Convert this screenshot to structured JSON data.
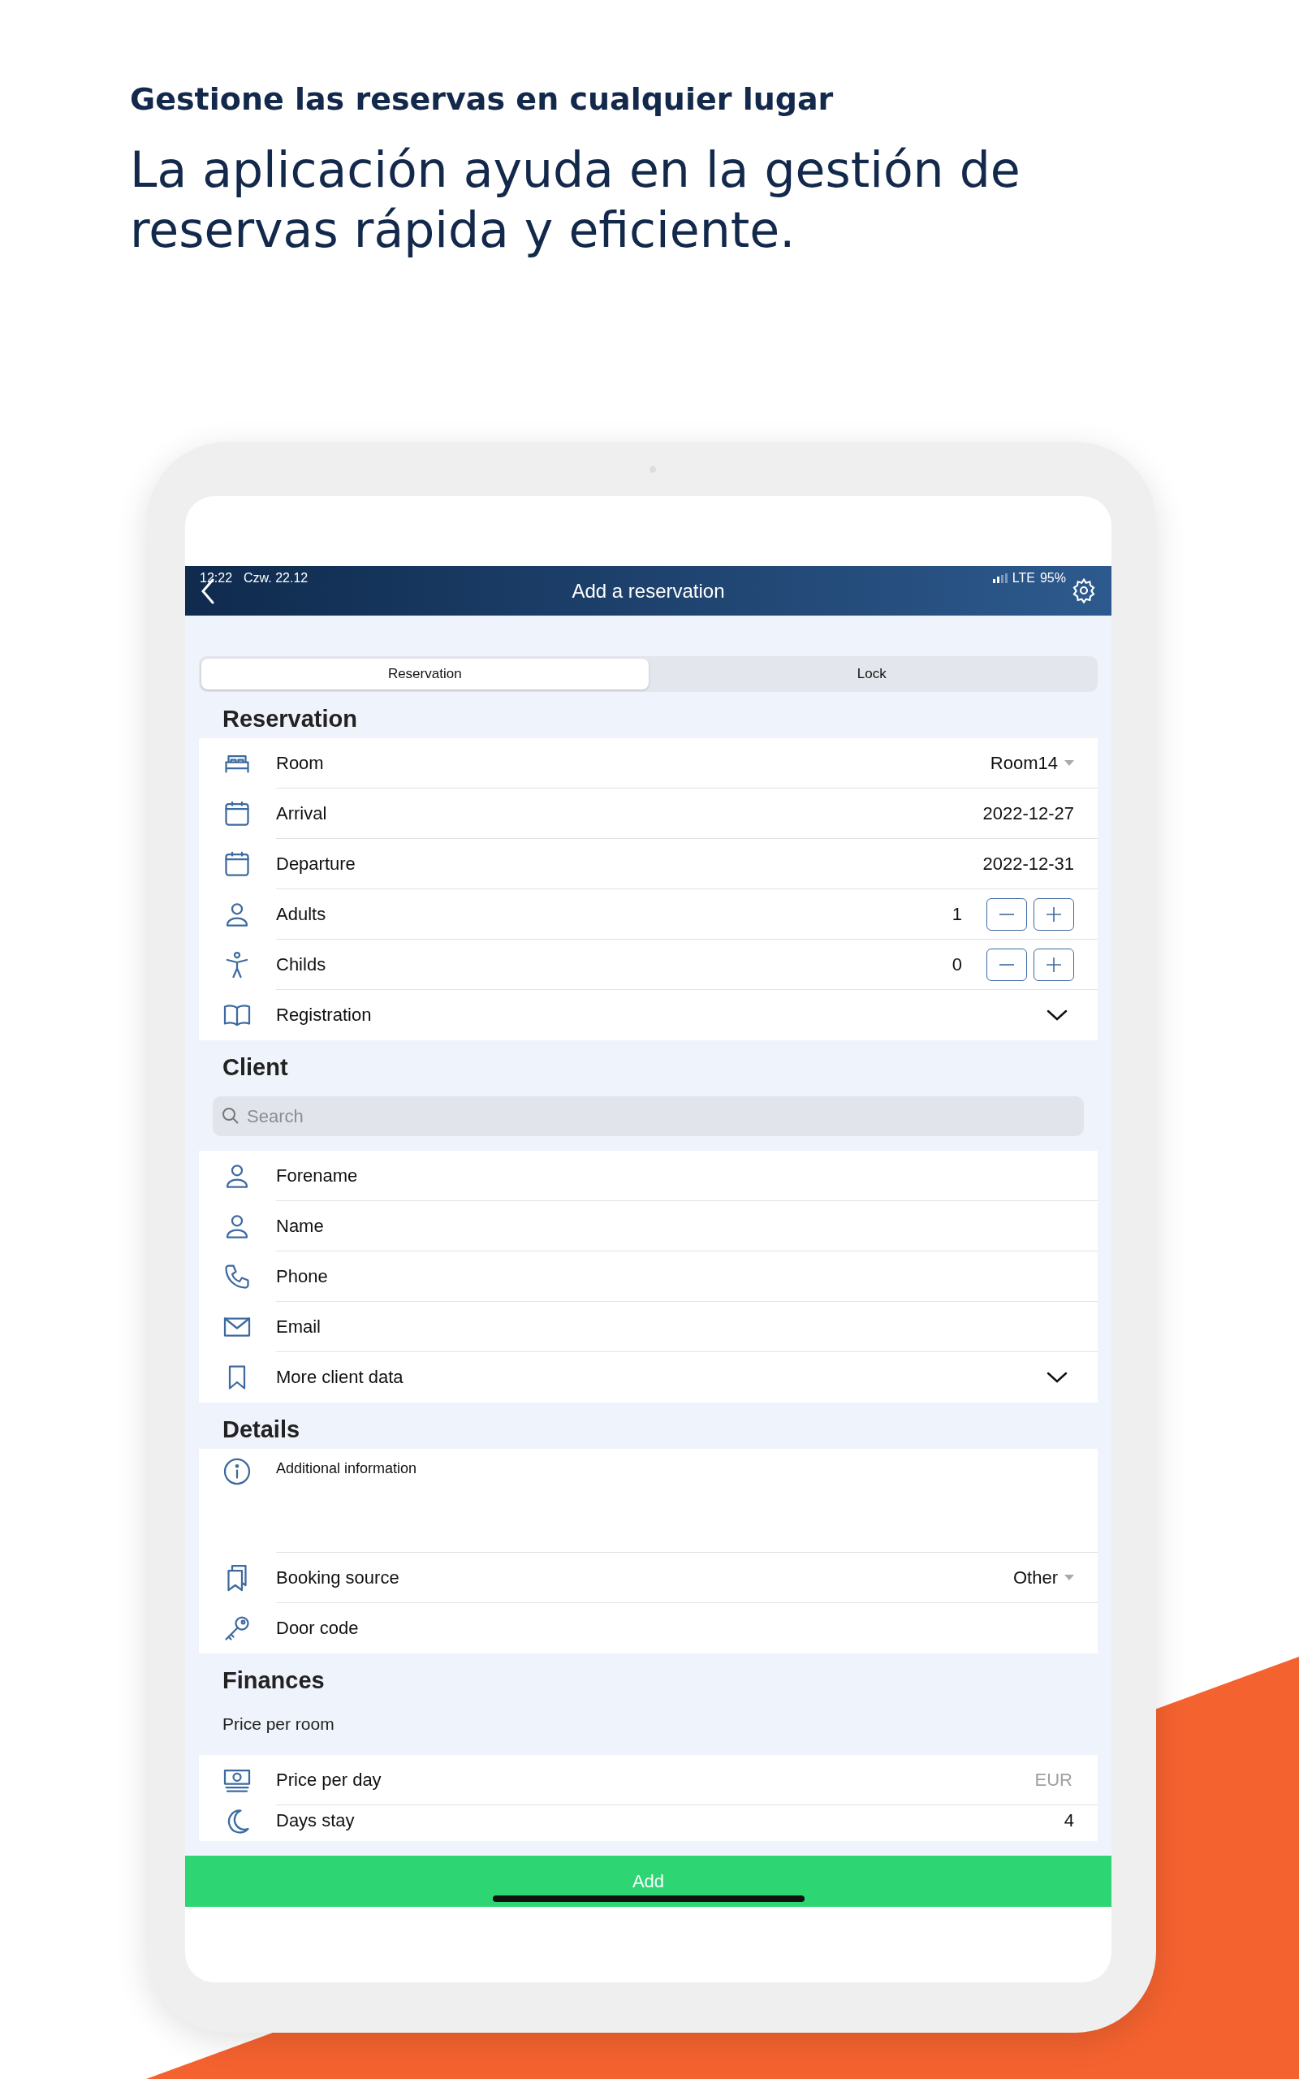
{
  "header": {
    "eyebrow": "Gestione las reservas en cualquier lugar",
    "headline": "La aplicación ayuda en la gestión de reservas rápida y eficiente."
  },
  "status_bar": {
    "time": "12:22",
    "date": "Czw. 22.12",
    "network": "LTE",
    "battery": "95%"
  },
  "nav_bar": {
    "title": "Add a reservation"
  },
  "tabs": [
    {
      "label": "Reservation",
      "selected": true
    },
    {
      "label": "Lock",
      "selected": false
    }
  ],
  "sections": [
    {
      "title": "Reservation",
      "rows": [
        {
          "kind": "select",
          "label": "Room",
          "value": "Room14"
        },
        {
          "kind": "value",
          "label": "Arrival",
          "value": "2022-12-27"
        },
        {
          "kind": "value",
          "label": "Departure",
          "value": "2022-12-31"
        },
        {
          "kind": "stepper",
          "label": "Adults",
          "value": "1"
        },
        {
          "kind": "stepper",
          "label": "Childs",
          "value": "0"
        },
        {
          "kind": "expand",
          "label": "Registration",
          "expanded": false
        }
      ]
    },
    {
      "title": "Client",
      "search": {
        "placeholder": "Search"
      },
      "rows": [
        {
          "kind": "field",
          "label": "Forename"
        },
        {
          "kind": "field",
          "label": "Name"
        },
        {
          "kind": "field",
          "label": "Phone"
        },
        {
          "kind": "field",
          "label": "Email"
        },
        {
          "kind": "expand",
          "label": "More client data",
          "expanded": false
        }
      ]
    },
    {
      "title": "Details",
      "rows": [
        {
          "kind": "note",
          "label": "Additional information"
        },
        {
          "kind": "select",
          "label": "Booking source",
          "value": "Other"
        },
        {
          "kind": "field",
          "label": "Door code"
        }
      ]
    },
    {
      "title": "Finances",
      "subtitle": "Price per room",
      "rows": [
        {
          "kind": "field",
          "label": "Price per day",
          "placeholder": "EUR"
        },
        {
          "kind": "value",
          "label": "Days stay",
          "value": "4"
        }
      ]
    }
  ],
  "add_button": {
    "label": "Add"
  }
}
